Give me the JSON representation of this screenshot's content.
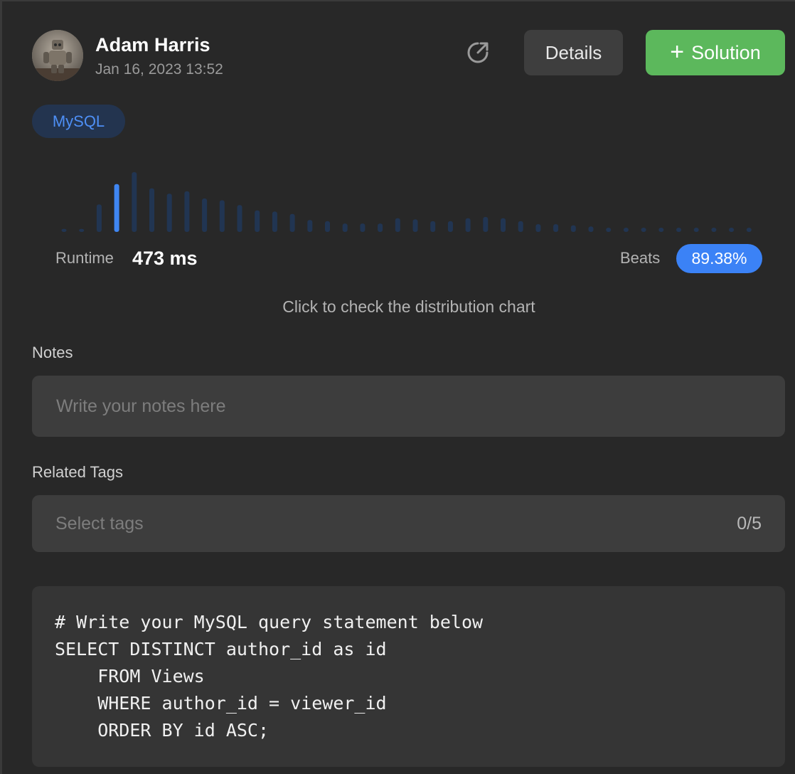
{
  "header": {
    "user_name": "Adam Harris",
    "timestamp": "Jan 16, 2023 13:52",
    "avatar_icon": "avatar-robot-photo",
    "share_icon": "share-arrow-icon",
    "details_label": "Details",
    "solution_plus": "+",
    "solution_label": "Solution"
  },
  "language_badge": "MySQL",
  "stats": {
    "runtime_label": "Runtime",
    "runtime_value": "473 ms",
    "beats_label": "Beats",
    "beats_value": "89.38%",
    "chart_hint": "Click to check the distribution chart"
  },
  "chart_data": {
    "type": "bar",
    "highlight_index": 3,
    "values": [
      0.05,
      0.05,
      0.46,
      0.8,
      1.0,
      0.73,
      0.64,
      0.68,
      0.56,
      0.53,
      0.45,
      0.36,
      0.34,
      0.3,
      0.2,
      0.18,
      0.14,
      0.14,
      0.14,
      0.23,
      0.21,
      0.18,
      0.18,
      0.23,
      0.25,
      0.23,
      0.18,
      0.13,
      0.13,
      0.11,
      0.09,
      0.07,
      0.07,
      0.07,
      0.07,
      0.07,
      0.07,
      0.07,
      0.07,
      0.07
    ],
    "colors": {
      "bar": "#213552",
      "highlight": "#3f86f2"
    }
  },
  "notes": {
    "heading": "Notes",
    "placeholder": "Write your notes here",
    "value": ""
  },
  "tags": {
    "heading": "Related Tags",
    "placeholder": "Select tags",
    "count": "0/5"
  },
  "code": {
    "lines": [
      "# Write your MySQL query statement below",
      "SELECT DISTINCT author_id as id",
      "    FROM Views",
      "    WHERE author_id = viewer_id",
      "    ORDER BY id ASC;"
    ]
  },
  "colors": {
    "background": "#282828",
    "accent_green": "#5cb85c",
    "accent_blue": "#3b82f6",
    "badge_bg": "#23344f",
    "badge_text": "#4e8ff5"
  }
}
